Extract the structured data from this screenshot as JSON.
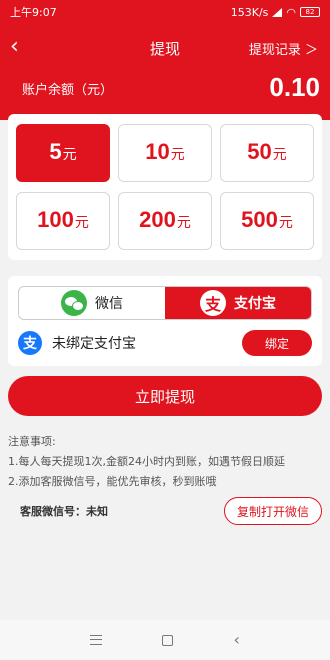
{
  "status_bar": {
    "time": "上午9:07",
    "speed": "153K/s",
    "battery": "82"
  },
  "header": {
    "title": "提现",
    "records_link": "提现记录 ＞",
    "balance_label": "账户余额（元）",
    "balance_value": "0.10"
  },
  "amounts": [
    {
      "value": "5",
      "unit": "元",
      "selected": true
    },
    {
      "value": "10",
      "unit": "元",
      "selected": false
    },
    {
      "value": "50",
      "unit": "元",
      "selected": false
    },
    {
      "value": "100",
      "unit": "元",
      "selected": false
    },
    {
      "value": "200",
      "unit": "元",
      "selected": false
    },
    {
      "value": "500",
      "unit": "元",
      "selected": false
    }
  ],
  "payment": {
    "wechat_label": "微信",
    "alipay_label": "支付宝",
    "alipay_glyph": "支",
    "unbound_text": "未绑定支付宝",
    "bind_button": "绑定"
  },
  "withdraw_button": "立即提现",
  "notes": {
    "title": "注意事项:",
    "line1": "1.每人每天提现1次,金额24小时内到账，如遇节假日顺延",
    "line2": "2.添加客服微信号，能优先审核，秒到账哦"
  },
  "service": {
    "label": "客服微信号：未知",
    "copy_button": "复制打开微信"
  },
  "colors": {
    "brand": "#e0141e",
    "wechat": "#3bb54a",
    "alipay": "#1677ff"
  }
}
